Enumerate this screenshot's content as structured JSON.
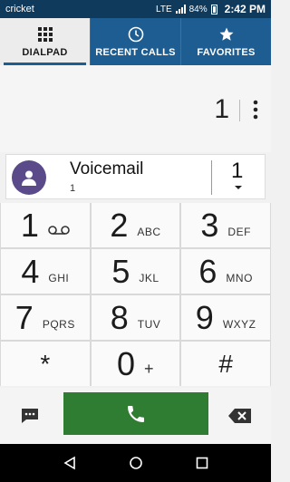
{
  "status_bar": {
    "carrier": "cricket",
    "network": "LTE",
    "battery": "84%",
    "time": "2:42 PM"
  },
  "tabs": [
    {
      "label": "DIALPAD",
      "icon": "dialpad-grid-icon",
      "active": true
    },
    {
      "label": "RECENT CALLS",
      "icon": "clock-icon",
      "active": false
    },
    {
      "label": "FAVORITES",
      "icon": "star-icon",
      "active": false
    }
  ],
  "entry": {
    "number": "1"
  },
  "suggestion": {
    "name": "Voicemail",
    "number": "1",
    "speed_dial": "1"
  },
  "keypad": [
    {
      "digit": "1",
      "letters": "",
      "extra": "voicemail-icon"
    },
    {
      "digit": "2",
      "letters": "ABC"
    },
    {
      "digit": "3",
      "letters": "DEF"
    },
    {
      "digit": "4",
      "letters": "GHI"
    },
    {
      "digit": "5",
      "letters": "JKL"
    },
    {
      "digit": "6",
      "letters": "MNO"
    },
    {
      "digit": "7",
      "letters": "PQRS"
    },
    {
      "digit": "8",
      "letters": "TUV"
    },
    {
      "digit": "9",
      "letters": "WXYZ"
    },
    {
      "digit": "*",
      "letters": ""
    },
    {
      "digit": "0",
      "letters": "+"
    },
    {
      "digit": "#",
      "letters": ""
    }
  ],
  "colors": {
    "status_bar": "#0f3a5c",
    "tab_bar": "#1d5d92",
    "call_button": "#2e7d32",
    "avatar": "#5a4a8a"
  }
}
